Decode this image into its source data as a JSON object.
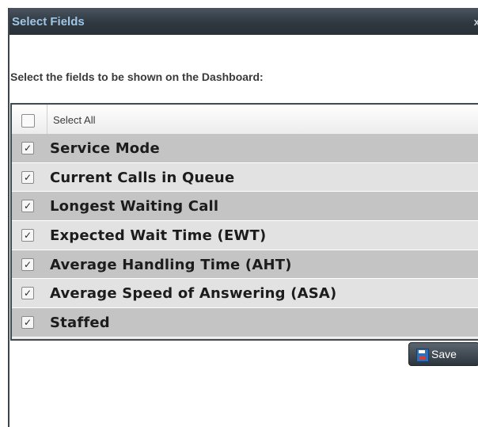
{
  "dialog": {
    "title": "Select Fields",
    "close_glyph": "x",
    "instruction": "Select the fields to be shown on the Dashboard:",
    "select_all_label": "Select All",
    "select_all_checked": false,
    "fields": [
      {
        "label": "Service Mode",
        "checked": true
      },
      {
        "label": "Current Calls in Queue",
        "checked": true
      },
      {
        "label": "Longest Waiting Call",
        "checked": true
      },
      {
        "label": "Expected Wait Time (EWT)",
        "checked": true
      },
      {
        "label": "Average Handling Time (AHT)",
        "checked": true
      },
      {
        "label": "Average Speed of Answering (ASA)",
        "checked": true
      },
      {
        "label": "Staffed",
        "checked": true
      }
    ],
    "save_label": "Save",
    "save_icon": "floppy-disk-icon",
    "check_glyph": "✓"
  }
}
